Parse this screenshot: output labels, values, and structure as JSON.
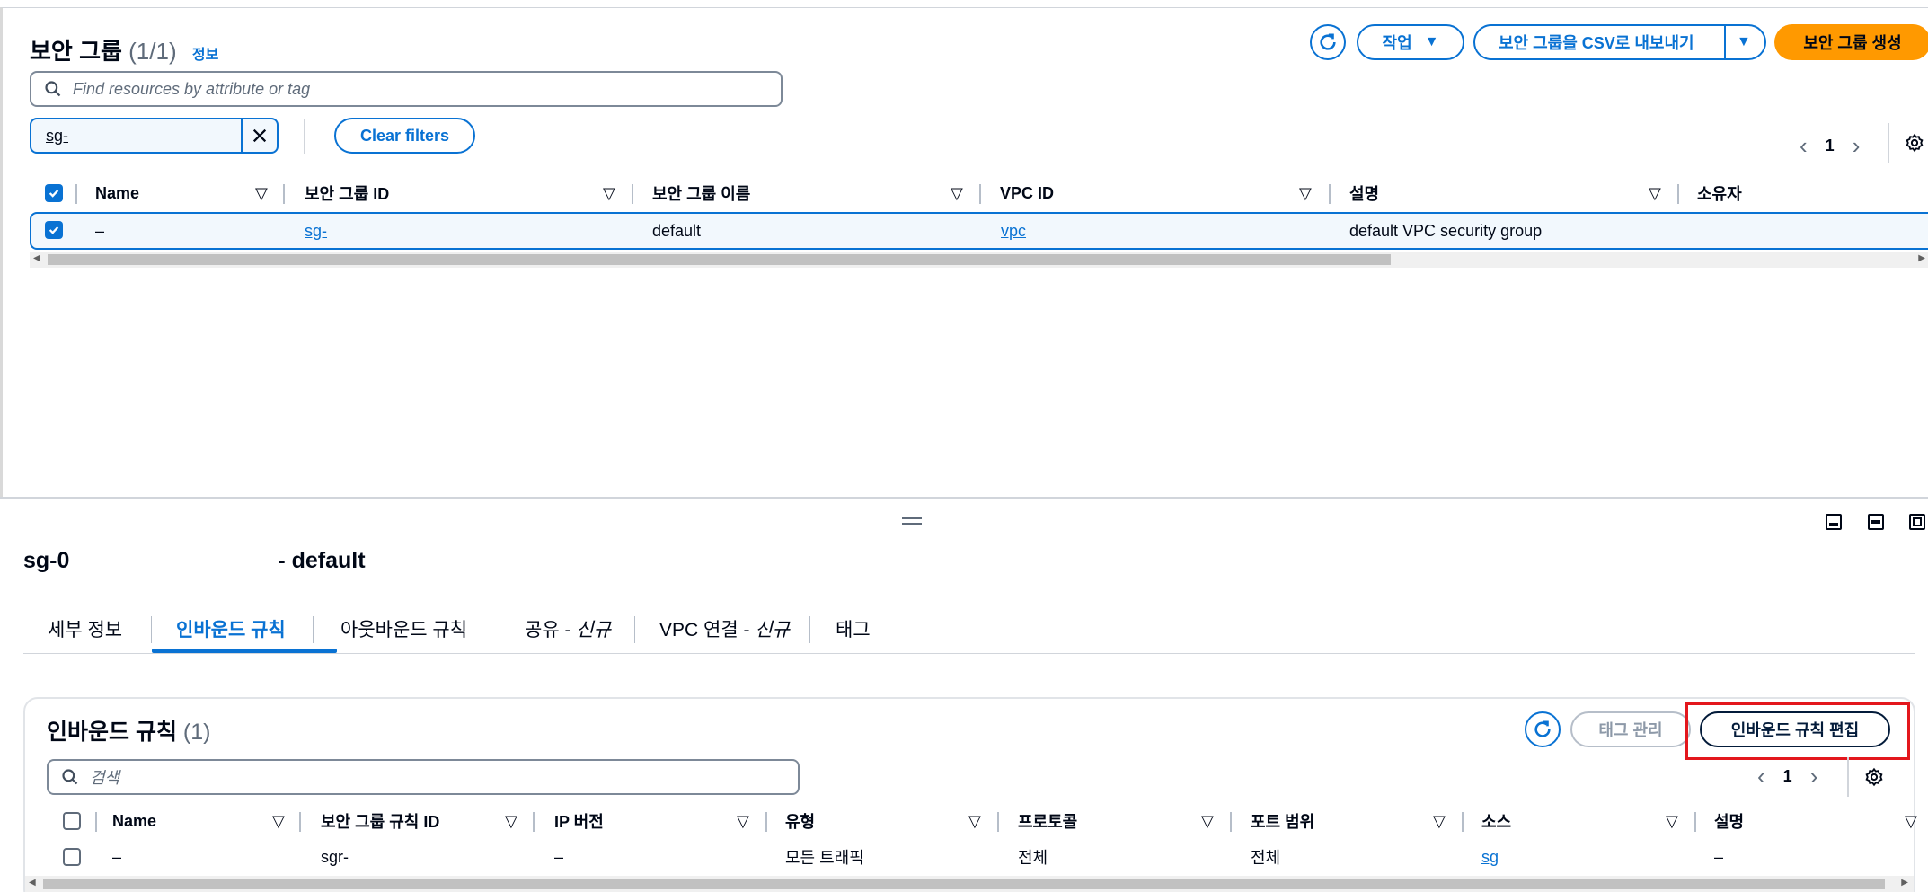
{
  "top": {
    "title": "보안 그룹",
    "count": "(1/1)",
    "info": "정보",
    "actions_label": "작업",
    "export_label": "보안 그룹을 CSV로 내보내기",
    "create_label": "보안 그룹 생성",
    "search_placeholder": "Find resources by attribute or tag",
    "filter_chip": "sg-",
    "clear_filters": "Clear filters",
    "page": "1",
    "columns": [
      "Name",
      "보안 그룹 ID",
      "보안 그룹 이름",
      "VPC ID",
      "설명",
      "소유자"
    ],
    "row": {
      "name": "–",
      "sg_id": "sg-",
      "sg_name": "default",
      "vpc_id": "vpc",
      "description": "default VPC security group"
    }
  },
  "detail": {
    "title_prefix": "sg-0",
    "title_suffix": "- default",
    "tabs": {
      "details": "세부 정보",
      "inbound": "인바운드 규칙",
      "outbound": "아웃바운드 규칙",
      "sharing": "공유 - ",
      "sharing_new": "신규",
      "vpc": "VPC 연결 - ",
      "vpc_new": "신규",
      "tags": "태그"
    }
  },
  "inbound": {
    "title": "인바운드 규칙",
    "count": "(1)",
    "manage_tags": "태그 관리",
    "edit_rules": "인바운드 규칙 편집",
    "search_placeholder": "검색",
    "page": "1",
    "columns": [
      "Name",
      "보안 그룹 규칙 ID",
      "IP 버전",
      "유형",
      "프로토콜",
      "포트 범위",
      "소스",
      "설명"
    ],
    "row": {
      "name": "–",
      "rule_id": "sgr-",
      "ip_version": "–",
      "type": "모든 트래픽",
      "protocol": "전체",
      "port_range": "전체",
      "source": "sg",
      "description": "–"
    }
  },
  "colors": {
    "accent": "#0972d3",
    "primary_button": "#ff9900",
    "highlight": "#e3171d"
  }
}
